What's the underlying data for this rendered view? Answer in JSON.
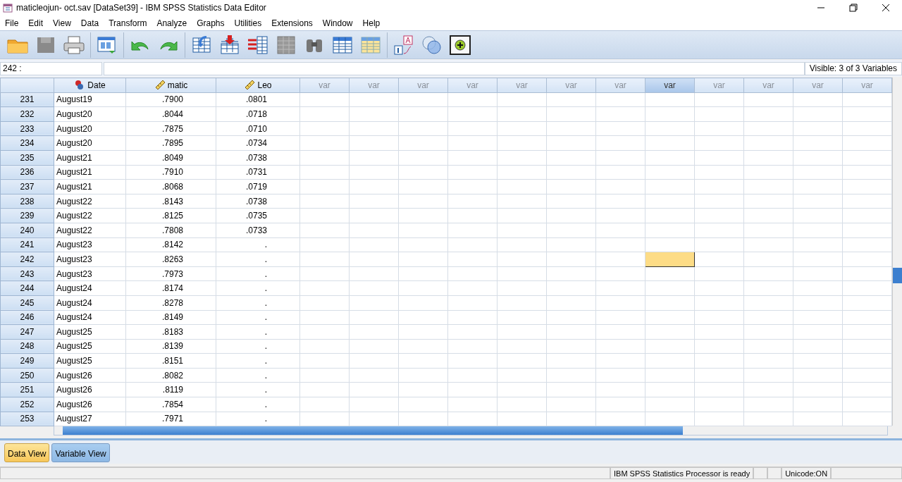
{
  "window": {
    "title": "maticleojun- oct.sav [DataSet39] - IBM SPSS Statistics Data Editor"
  },
  "menu": [
    "File",
    "Edit",
    "View",
    "Data",
    "Transform",
    "Analyze",
    "Graphs",
    "Utilities",
    "Extensions",
    "Window",
    "Help"
  ],
  "cell_editor": {
    "cell": "242 :",
    "visible": "Visible: 3 of 3 Variables"
  },
  "columns": [
    {
      "label": "Date",
      "kind": "nominal",
      "selected": false
    },
    {
      "label": "matic",
      "kind": "scale",
      "selected": false
    },
    {
      "label": "Leo",
      "kind": "scale",
      "selected": false
    },
    {
      "label": "var",
      "kind": "empty",
      "selected": false
    },
    {
      "label": "var",
      "kind": "empty",
      "selected": false
    },
    {
      "label": "var",
      "kind": "empty",
      "selected": false
    },
    {
      "label": "var",
      "kind": "empty",
      "selected": false
    },
    {
      "label": "var",
      "kind": "empty",
      "selected": false
    },
    {
      "label": "var",
      "kind": "empty",
      "selected": false
    },
    {
      "label": "var",
      "kind": "empty",
      "selected": false
    },
    {
      "label": "var",
      "kind": "empty",
      "selected": true
    },
    {
      "label": "var",
      "kind": "empty",
      "selected": false
    },
    {
      "label": "var",
      "kind": "empty",
      "selected": false
    },
    {
      "label": "var",
      "kind": "empty",
      "selected": false
    },
    {
      "label": "var",
      "kind": "empty",
      "selected": false
    }
  ],
  "rows": [
    {
      "case": "231",
      "cells": [
        "August19",
        ".7900",
        ".0801"
      ],
      "selected": false
    },
    {
      "case": "232",
      "cells": [
        "August20",
        ".8044",
        ".0718"
      ],
      "selected": false
    },
    {
      "case": "233",
      "cells": [
        "August20",
        ".7875",
        ".0710"
      ],
      "selected": false
    },
    {
      "case": "234",
      "cells": [
        "August20",
        ".7895",
        ".0734"
      ],
      "selected": false
    },
    {
      "case": "235",
      "cells": [
        "August21",
        ".8049",
        ".0738"
      ],
      "selected": false
    },
    {
      "case": "236",
      "cells": [
        "August21",
        ".7910",
        ".0731"
      ],
      "selected": false
    },
    {
      "case": "237",
      "cells": [
        "August21",
        ".8068",
        ".0719"
      ],
      "selected": false
    },
    {
      "case": "238",
      "cells": [
        "August22",
        ".8143",
        ".0738"
      ],
      "selected": false
    },
    {
      "case": "239",
      "cells": [
        "August22",
        ".8125",
        ".0735"
      ],
      "selected": false
    },
    {
      "case": "240",
      "cells": [
        "August22",
        ".7808",
        ".0733"
      ],
      "selected": false
    },
    {
      "case": "241",
      "cells": [
        "August23",
        ".8142",
        "."
      ],
      "selected": false
    },
    {
      "case": "242",
      "cells": [
        "August23",
        ".8263",
        "."
      ],
      "selected": true
    },
    {
      "case": "243",
      "cells": [
        "August23",
        ".7973",
        "."
      ],
      "selected": false
    },
    {
      "case": "244",
      "cells": [
        "August24",
        ".8174",
        "."
      ],
      "selected": false
    },
    {
      "case": "245",
      "cells": [
        "August24",
        ".8278",
        "."
      ],
      "selected": false
    },
    {
      "case": "246",
      "cells": [
        "August24",
        ".8149",
        "."
      ],
      "selected": false
    },
    {
      "case": "247",
      "cells": [
        "August25",
        ".8183",
        "."
      ],
      "selected": false
    },
    {
      "case": "248",
      "cells": [
        "August25",
        ".8139",
        "."
      ],
      "selected": false
    },
    {
      "case": "249",
      "cells": [
        "August25",
        ".8151",
        "."
      ],
      "selected": false
    },
    {
      "case": "250",
      "cells": [
        "August26",
        ".8082",
        "."
      ],
      "selected": false
    },
    {
      "case": "251",
      "cells": [
        "August26",
        ".8119",
        "."
      ],
      "selected": false
    },
    {
      "case": "252",
      "cells": [
        "August26",
        ".7854",
        "."
      ],
      "selected": false
    },
    {
      "case": "253",
      "cells": [
        "August27",
        ".7971",
        "."
      ],
      "selected": false
    }
  ],
  "view_tabs": [
    {
      "label": "Data View",
      "selected": true
    },
    {
      "label": "Variable View",
      "selected": false
    }
  ],
  "status_bar": [
    "IBM SPSS Statistics Processor is ready",
    "Unicode:ON"
  ]
}
